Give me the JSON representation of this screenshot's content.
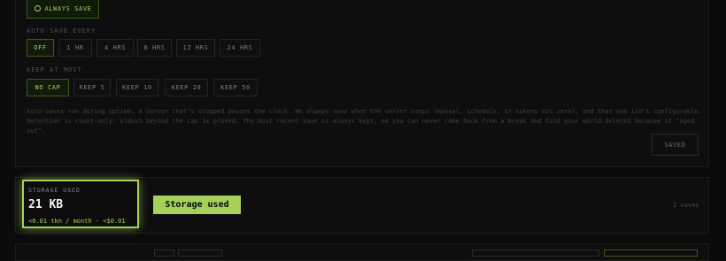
{
  "auto_save": {
    "always_save_label": "ALWAYS SAVE",
    "every_label": "AUTO-SAVE EVERY",
    "every_options": [
      "OFF",
      "1 HR",
      "4 HRS",
      "8 HRS",
      "12 HRS",
      "24 HRS"
    ],
    "every_selected": "OFF",
    "keep_label": "KEEP AT MOST",
    "keep_options": [
      "NO CAP",
      "KEEP 5",
      "KEEP 10",
      "KEEP 20",
      "KEEP 50"
    ],
    "keep_selected": "NO CAP",
    "help_line1": "Auto-saves run during uptime; a server that's stopped pauses the clock. We always save when the server stops (manual, schedule, or tokens hit zero), and that one isn't configurable.",
    "help_line2": "Retention is count-only: oldest beyond the cap is pruned. The most recent save is always kept, so you can never come back from a break and find your world deleted because it \"aged out\".",
    "saved_button": "SAVED"
  },
  "storage": {
    "caption": "STORAGE USED",
    "value": "21 KB",
    "cost": "<0.01 tkn / month · <$0.01",
    "tooltip": "Storage used",
    "saves_count": "2 saves"
  },
  "colors": {
    "accent": "#a5d05a",
    "background": "#0b0b0b"
  }
}
